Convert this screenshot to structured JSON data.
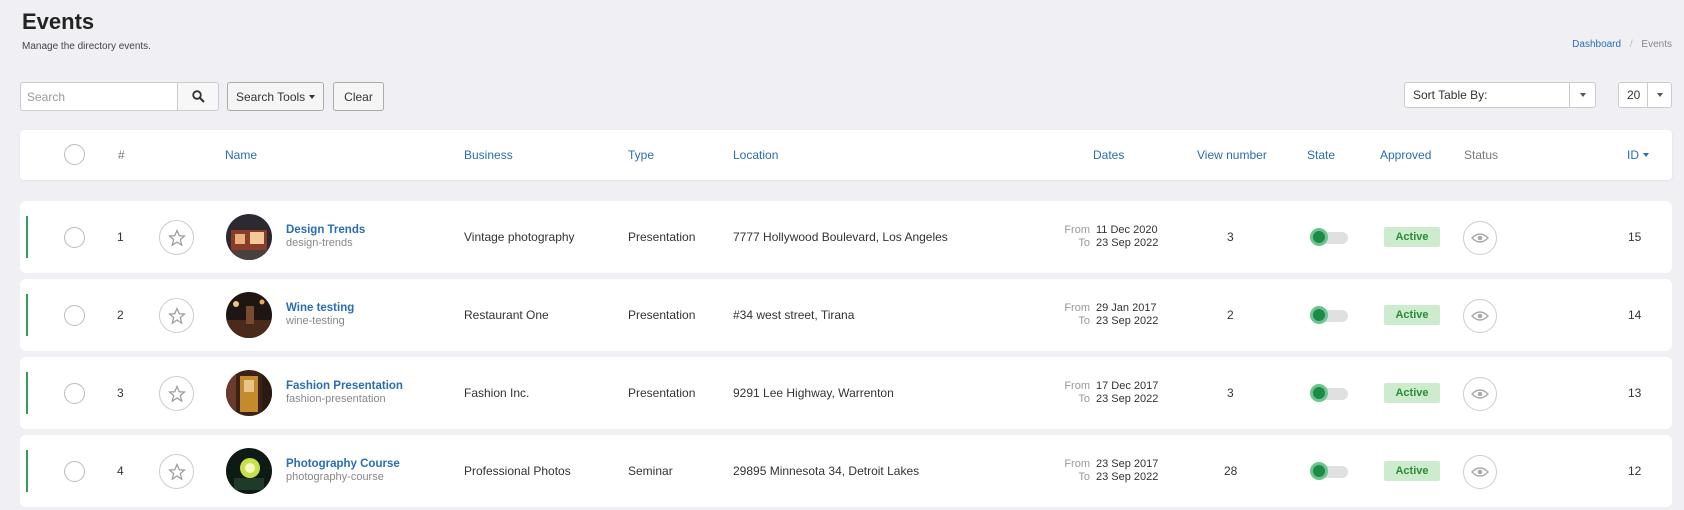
{
  "page": {
    "title": "Events",
    "subtitle": "Manage the directory events."
  },
  "breadcrumb": {
    "items": [
      "Dashboard",
      "Events"
    ]
  },
  "toolbar": {
    "search_placeholder": "Search",
    "search_icon": "search-icon",
    "search_tools_label": "Search Tools",
    "clear_label": "Clear",
    "sort_label": "Sort Table By:",
    "limit_value": "20"
  },
  "table": {
    "headers": {
      "number": "#",
      "name": "Name",
      "business": "Business",
      "type": "Type",
      "location": "Location",
      "dates": "Dates",
      "views": "View number",
      "state": "State",
      "approved": "Approved",
      "status": "Status",
      "id": "ID"
    },
    "date_from_label": "From",
    "date_to_label": "To",
    "rows": [
      {
        "num": "1",
        "name": "Design Trends",
        "alias": "design-trends",
        "business": "Vintage photography",
        "type": "Presentation",
        "location": "7777 Hollywood Boulevard, Los Angeles",
        "from": "11 Dec 2020",
        "to": "23 Sep 2022",
        "views": "3",
        "state": true,
        "approved": true,
        "status": "Active",
        "id": "15"
      },
      {
        "num": "2",
        "name": "Wine testing",
        "alias": "wine-testing",
        "business": "Restaurant One",
        "type": "Presentation",
        "location": "#34 west street, Tirana",
        "from": "29 Jan 2017",
        "to": "23 Sep 2022",
        "views": "2",
        "state": true,
        "approved": true,
        "status": "Active",
        "id": "14"
      },
      {
        "num": "3",
        "name": "Fashion Presentation",
        "alias": "fashion-presentation",
        "business": "Fashion Inc.",
        "type": "Presentation",
        "location": "9291 Lee Highway, Warrenton",
        "from": "17 Dec 2017",
        "to": "23 Sep 2022",
        "views": "3",
        "state": true,
        "approved": true,
        "status": "Active",
        "id": "13"
      },
      {
        "num": "4",
        "name": "Photography Course",
        "alias": "photography-course",
        "business": "Professional Photos",
        "type": "Seminar",
        "location": "29895 Minnesota 34, Detroit Lakes",
        "from": "23 Sep 2017",
        "to": "23 Sep 2022",
        "views": "28",
        "state": true,
        "approved": true,
        "status": "Active",
        "id": "12"
      }
    ]
  },
  "colors": {
    "accent": "#2ea05a",
    "link": "#2a6db5",
    "badge_bg": "#cdeccd",
    "badge_text": "#2a8b3a",
    "toggle_on": "#1d8a47"
  }
}
